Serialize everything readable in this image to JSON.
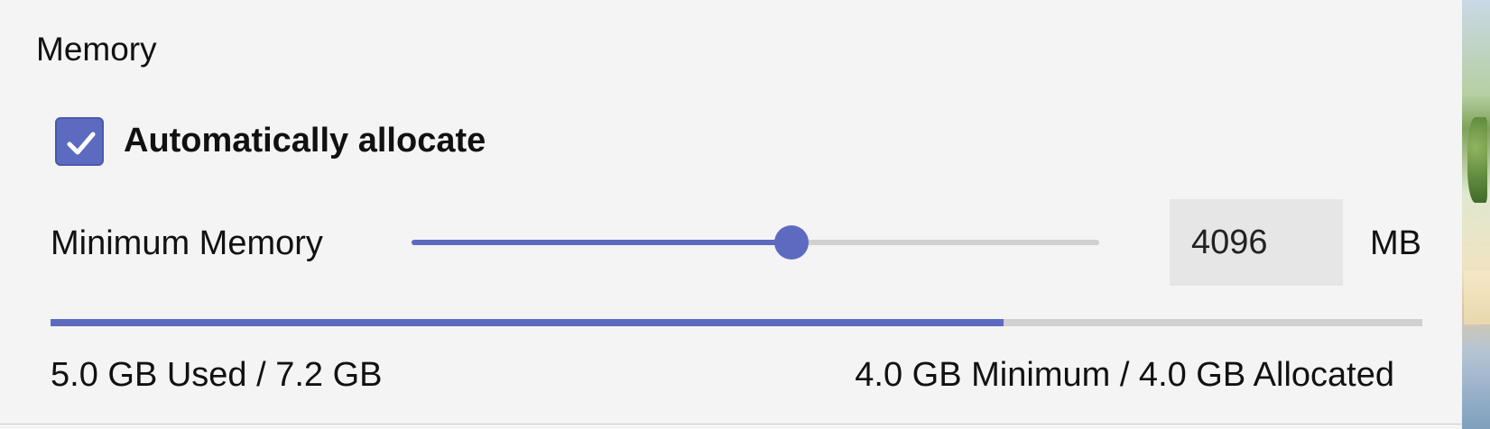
{
  "memory": {
    "section_title": "Memory",
    "auto_allocate": {
      "label": "Automatically allocate",
      "checked": true
    },
    "minimum_memory": {
      "label": "Minimum Memory",
      "value": "4096",
      "unit": "MB",
      "slider_fraction": 0.553
    },
    "usage": {
      "used_fraction": 0.695,
      "used_text": "5.0 GB Used / 7.2 GB",
      "allocated_text": "4.0 GB Minimum / 4.0 GB Allocated"
    }
  },
  "colors": {
    "accent": "#5c6bc0",
    "track": "#d0d0d0",
    "background": "#f4f4f4",
    "input_background": "#e6e6e6"
  },
  "icons": {
    "checkbox": "check-icon"
  }
}
